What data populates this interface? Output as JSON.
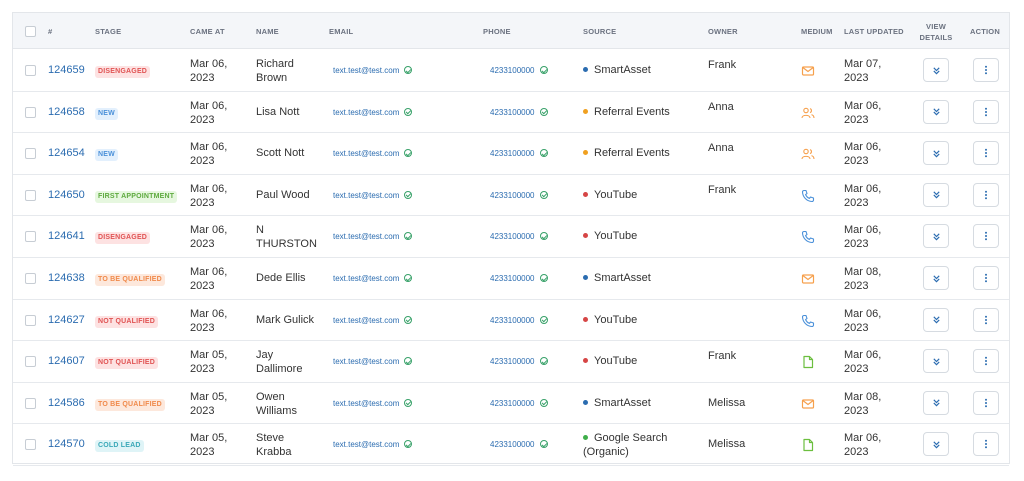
{
  "columns": {
    "num": "#",
    "stage": "STAGE",
    "came_at": "CAME AT",
    "name": "NAME",
    "email": "EMAIL",
    "phone": "PHONE",
    "source": "SOURCE",
    "owner": "OWNER",
    "medium": "MEDIUM",
    "last_updated": "LAST UPDATED",
    "view_details_1": "VIEW",
    "view_details_2": "DETAILS",
    "action": "ACTION"
  },
  "colors": {
    "link": "#2b6cb0",
    "check_green": "#38a169",
    "medium_orange": "#f6a04d",
    "medium_blue": "#4a90d9",
    "medium_green": "#6cbf3f"
  },
  "stage_styles": {
    "DISENGAGED": {
      "bg": "#fde2e2",
      "fg": "#e05353"
    },
    "NEW": {
      "bg": "#e3f0fd",
      "fg": "#4a90d9"
    },
    "FIRST APPOINTMENT": {
      "bg": "#e6f7df",
      "fg": "#5eaa3e"
    },
    "TO BE QUALIFIED": {
      "bg": "#fde8dc",
      "fg": "#f08a4b"
    },
    "NOT QUALIFIED": {
      "bg": "#fde2e2",
      "fg": "#e05353"
    },
    "COLD LEAD": {
      "bg": "#dff4f7",
      "fg": "#3aa8b8"
    }
  },
  "source_colors": {
    "SmartAsset": "#2b6cb0",
    "Referral Events": "#f0a020",
    "YouTube": "#d64545",
    "Google Search (Organic)": "#3fae4a"
  },
  "rows": [
    {
      "id": "124659",
      "stage": "DISENGAGED",
      "came1": "Mar 06,",
      "came2": "2023",
      "name1": "Richard",
      "name2": "Brown",
      "email": "text.test@test.com",
      "phone": "4233100000",
      "source1": "SmartAsset",
      "source2": "",
      "owner": "Frank",
      "medium": "mail-icon",
      "upd1": "Mar 07,",
      "upd2": "2023"
    },
    {
      "id": "124658",
      "stage": "NEW",
      "came1": "Mar 06,",
      "came2": "2023",
      "name1": "Lisa Nott",
      "name2": "",
      "email": "text.test@test.com",
      "phone": "4233100000",
      "source1": "Referral Events",
      "source2": "",
      "owner": "Anna",
      "medium": "users-icon",
      "upd1": "Mar 06,",
      "upd2": "2023"
    },
    {
      "id": "124654",
      "stage": "NEW",
      "came1": "Mar 06,",
      "came2": "2023",
      "name1": "Scott Nott",
      "name2": "",
      "email": "text.test@test.com",
      "phone": "4233100000",
      "source1": "Referral Events",
      "source2": "",
      "owner": "Anna",
      "medium": "users-icon",
      "upd1": "Mar 06,",
      "upd2": "2023"
    },
    {
      "id": "124650",
      "stage": "FIRST APPOINTMENT",
      "came1": "Mar 06,",
      "came2": "2023",
      "name1": "Paul Wood",
      "name2": "",
      "email": "text.test@test.com",
      "phone": "4233100000",
      "source1": "YouTube",
      "source2": "",
      "owner": "Frank",
      "medium": "phone-icon",
      "upd1": "Mar 06,",
      "upd2": "2023"
    },
    {
      "id": "124641",
      "stage": "DISENGAGED",
      "came1": "Mar 06,",
      "came2": "2023",
      "name1": "N",
      "name2": "THURSTON",
      "email": "text.test@test.com",
      "phone": "4233100000",
      "source1": "YouTube",
      "source2": "",
      "owner": "",
      "medium": "phone-icon",
      "upd1": "Mar 06,",
      "upd2": "2023"
    },
    {
      "id": "124638",
      "stage": "TO BE QUALIFIED",
      "came1": "Mar 06,",
      "came2": "2023",
      "name1": "Dede Ellis",
      "name2": "",
      "email": "text.test@test.com",
      "phone": "4233100000",
      "source1": "SmartAsset",
      "source2": "",
      "owner": "",
      "medium": "mail-icon",
      "upd1": "Mar 08,",
      "upd2": "2023"
    },
    {
      "id": "124627",
      "stage": "NOT QUALIFIED",
      "came1": "Mar 06,",
      "came2": "2023",
      "name1": "Mark Gulick",
      "name2": "",
      "email": "text.test@test.com",
      "phone": "4233100000",
      "source1": "YouTube",
      "source2": "",
      "owner": "",
      "medium": "phone-icon",
      "upd1": "Mar 06,",
      "upd2": "2023"
    },
    {
      "id": "124607",
      "stage": "NOT QUALIFIED",
      "came1": "Mar 05,",
      "came2": "2023",
      "name1": "Jay",
      "name2": "Dallimore",
      "email": "text.test@test.com",
      "phone": "4233100000",
      "source1": "YouTube",
      "source2": "",
      "owner": "Frank",
      "medium": "file-icon",
      "upd1": "Mar 06,",
      "upd2": "2023"
    },
    {
      "id": "124586",
      "stage": "TO BE QUALIFIED",
      "came1": "Mar 05,",
      "came2": "2023",
      "name1": "Owen",
      "name2": "Williams",
      "email": "text.test@test.com",
      "phone": "4233100000",
      "source1": "SmartAsset",
      "source2": "",
      "owner": "Melissa",
      "medium": "mail-icon",
      "upd1": "Mar 08,",
      "upd2": "2023"
    },
    {
      "id": "124570",
      "stage": "COLD LEAD",
      "came1": "Mar 05,",
      "came2": "2023",
      "name1": "Steve",
      "name2": "Krabba",
      "email": "text.test@test.com",
      "phone": "4233100000",
      "source1": "Google Search",
      "source2": "(Organic)",
      "owner": "Melissa",
      "medium": "file-icon",
      "upd1": "Mar 06,",
      "upd2": "2023"
    }
  ]
}
